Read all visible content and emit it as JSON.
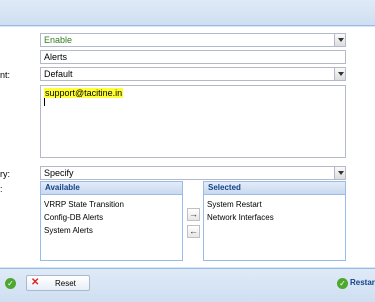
{
  "form": {
    "status_label": "",
    "status_value": "Enable",
    "name_value": "Alerts",
    "recipient_label": "nt:",
    "recipient_value": "Default",
    "email_value": "support@tacitine.in",
    "delivery_label": "ry:",
    "delivery_value": "Specify",
    "events_label": ":"
  },
  "available": {
    "header": "Available",
    "items": [
      "VRRP State Transition",
      "Config-DB Alerts",
      "System Alerts"
    ]
  },
  "selected": {
    "header": "Selected",
    "items": [
      "System Restart",
      "Network Interfaces"
    ]
  },
  "move_buttons": {
    "right": "→",
    "left": "←"
  },
  "footer": {
    "reset_label": "Reset",
    "restart_label": "Restar"
  },
  "icons": [
    "chevron-down-icon",
    "check-circle-icon",
    "reset-x-icon",
    "arrow-right-icon",
    "arrow-left-icon"
  ],
  "colors": {
    "accent": "#15428b",
    "header_bg": "#cfdff1",
    "highlight": "#ffff33",
    "status_green": "#2e7d1f"
  }
}
